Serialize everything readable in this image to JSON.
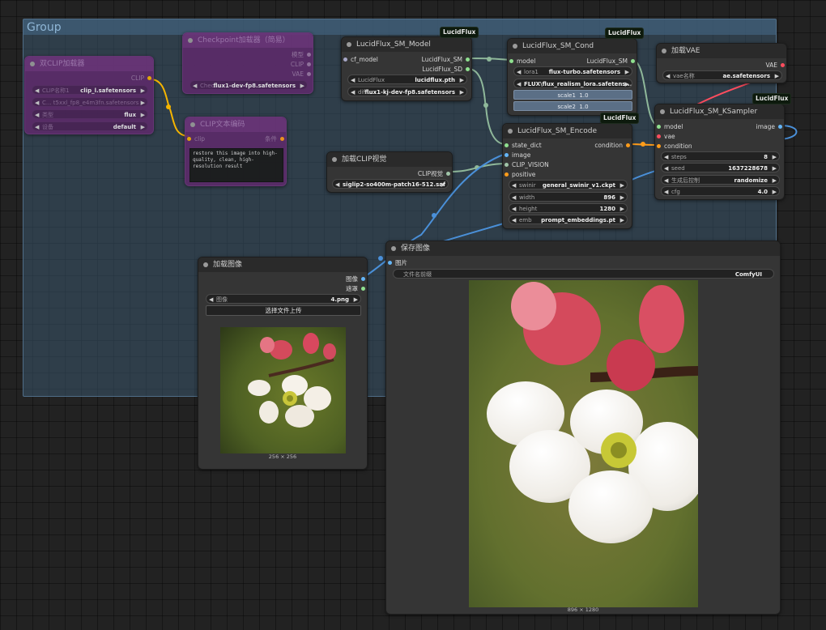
{
  "group": {
    "title": "Group"
  },
  "badge": "LucidFlux",
  "clip_loader": {
    "title": "双CLIP加载器",
    "output": "CLIP",
    "widgets": [
      {
        "label": "CLIP名称1",
        "value": "clip_l.safetensors"
      },
      {
        "label": "C... t5xxl_fp8_e4m3fn.safetensors",
        "value": ""
      },
      {
        "label": "类型",
        "value": "flux"
      },
      {
        "label": "设备",
        "value": "default"
      }
    ]
  },
  "checkpoint": {
    "title": "Checkpoint加载器（简易）",
    "outputs": [
      "模型",
      "CLIP",
      "VAE"
    ],
    "widget": {
      "label": "Chec...",
      "value": "flux1-dev-fp8.safetensors"
    }
  },
  "clip_text": {
    "title": "CLIP文本编码",
    "input": "clip",
    "output": "条件",
    "text": "restore this image into high-quality, clean, high-resolution result"
  },
  "sm_model": {
    "title": "LucidFlux_SM_Model",
    "input": "cf_model",
    "outputs": [
      "LucidFlux_SM",
      "LucidFlux_SD"
    ],
    "widgets": [
      {
        "label": "LucidFlux",
        "value": "lucidflux.pth"
      },
      {
        "label": "diffu...",
        "value": "flux1-kj-dev-fp8.safetensors"
      }
    ]
  },
  "sm_cond": {
    "title": "LucidFlux_SM_Cond",
    "input": "model",
    "output": "LucidFlux_SM",
    "widgets": [
      {
        "label": "lora1",
        "value": "flux-turbo.safetensors"
      },
      {
        "label": "",
        "value": "FLUX\\flux_realism_lora.safetens..."
      }
    ],
    "sliders": [
      {
        "label": "scale1",
        "value": "1.0"
      },
      {
        "label": "scale2",
        "value": "1.0"
      }
    ]
  },
  "vae": {
    "title": "加载VAE",
    "output": "VAE",
    "widget": {
      "label": "vae名称",
      "value": "ae.safetensors"
    }
  },
  "ksampler": {
    "title": "LucidFlux_SM_KSampler",
    "inputs": [
      "model",
      "vae",
      "condition"
    ],
    "output": "image",
    "widgets": [
      {
        "label": "steps",
        "value": "8"
      },
      {
        "label": "seed",
        "value": "1637228678"
      },
      {
        "label": "生成后控制",
        "value": "randomize"
      },
      {
        "label": "cfg",
        "value": "4.0"
      }
    ]
  },
  "encode": {
    "title": "LucidFlux_SM_Encode",
    "inputs": [
      "state_dict",
      "image",
      "CLIP_VISION",
      "positive"
    ],
    "output": "condition",
    "widgets": [
      {
        "label": "swinir",
        "value": "general_swinir_v1.ckpt"
      },
      {
        "label": "width",
        "value": "896"
      },
      {
        "label": "height",
        "value": "1280"
      },
      {
        "label": "emb",
        "value": "prompt_embeddings.pt"
      }
    ]
  },
  "clip_vision": {
    "title": "加载CLIP视觉",
    "output": "CLIP视觉",
    "widget": {
      "label": "",
      "value": "siglip2-so400m-patch16-512.saf ..."
    }
  },
  "load_image": {
    "title": "加载图像",
    "outputs": [
      "图像",
      "遮罩"
    ],
    "widget": {
      "label": "图像",
      "value": "4.png"
    },
    "button": "选择文件上传",
    "caption": "256 × 256"
  },
  "save_image": {
    "title": "保存图像",
    "input": "图片",
    "widget": {
      "label": "文件名前缀",
      "value": "ComfyUI"
    },
    "caption": "896 × 1280"
  },
  "colors": {
    "canvas": "#222222",
    "node": "#353535",
    "group": "#3b556c",
    "purple_node": "#5c2b6a",
    "link_green": "#7fa88c",
    "link_blue": "#4a90d9",
    "link_yellow": "#f5b400",
    "link_orange": "#ff9c1a",
    "link_red": "#ff4d5e"
  }
}
